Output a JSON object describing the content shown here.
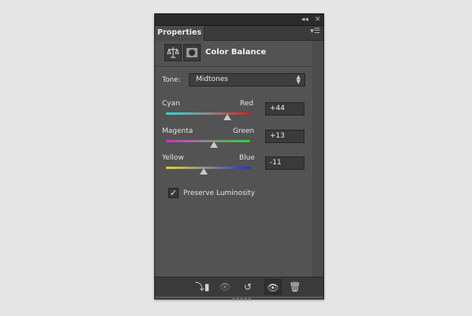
{
  "window": {
    "collapse_icon": "double-left-arrow-icon",
    "close_icon": "close-icon"
  },
  "tab": {
    "label": "Properties",
    "menu_icon": "panel-menu-icon"
  },
  "header": {
    "title": "Color Balance",
    "adjustment_icon": "balance-scale-icon",
    "mask_icon": "mask-icon"
  },
  "tone": {
    "label": "Tone:",
    "selected": "Midtones"
  },
  "sliders": [
    {
      "left_label": "Cyan",
      "right_label": "Red",
      "value": "+44",
      "position": 0.72
    },
    {
      "left_label": "Magenta",
      "right_label": "Green",
      "value": "+13",
      "position": 0.56
    },
    {
      "left_label": "Yellow",
      "right_label": "Blue",
      "value": "-11",
      "position": 0.45
    }
  ],
  "preserve_luminosity": {
    "label": "Preserve Luminosity",
    "checked": true
  },
  "footer_icons": [
    "clip-to-layer-icon",
    "view-previous-state-icon",
    "reset-icon",
    "visibility-eye-icon",
    "trash-icon"
  ],
  "colors": {
    "panel_bg": "#535353",
    "track_cyan_red": [
      "#2fd6d6",
      "#d42020"
    ],
    "track_magenta_green": [
      "#d22ad2",
      "#2ad22a"
    ],
    "track_yellow_blue": [
      "#d8d82a",
      "#2a2ad8"
    ]
  }
}
